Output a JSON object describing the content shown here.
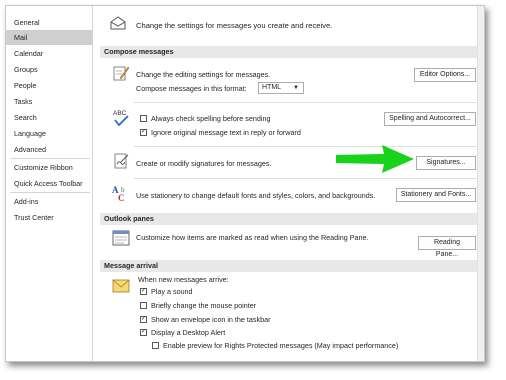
{
  "sidebar": {
    "items": [
      {
        "label": "General"
      },
      {
        "label": "Mail",
        "selected": true
      },
      {
        "label": "Calendar"
      },
      {
        "label": "Groups"
      },
      {
        "label": "People"
      },
      {
        "label": "Tasks"
      },
      {
        "label": "Search"
      },
      {
        "label": "Language"
      },
      {
        "label": "Advanced"
      },
      {
        "label": "Customize Ribbon"
      },
      {
        "label": "Quick Access Toolbar"
      },
      {
        "label": "Add-ins"
      },
      {
        "label": "Trust Center"
      }
    ]
  },
  "header": {
    "text": "Change the settings for messages you create and receive."
  },
  "compose": {
    "section_title": "Compose messages",
    "editing_text": "Change the editing settings for messages.",
    "format_label": "Compose messages in this format:",
    "format_value": "HTML",
    "editor_options_button": "Editor Options...",
    "spell_checkbox": "Always check spelling before sending",
    "spell_checked": false,
    "ignore_checkbox": "Ignore original message text in reply or forward",
    "ignore_checked": true,
    "spelling_button": "Spelling and Autocorrect...",
    "signatures_text": "Create or modify signatures for messages.",
    "signatures_button": "Signatures...",
    "stationery_text": "Use stationery to change default fonts and styles, colors, and backgrounds.",
    "stationery_button": "Stationery and Fonts..."
  },
  "outlook_panes": {
    "section_title": "Outlook panes",
    "reading_text": "Customize how items are marked as read when using the Reading Pane.",
    "reading_button": "Reading Pane..."
  },
  "message_arrival": {
    "section_title": "Message arrival",
    "intro": "When new messages arrive:",
    "options": [
      {
        "label": "Play a sound",
        "checked": true
      },
      {
        "label": "Briefly change the mouse pointer",
        "checked": false
      },
      {
        "label": "Show an envelope icon in the taskbar",
        "checked": true
      },
      {
        "label": "Display a Desktop Alert",
        "checked": true
      },
      {
        "label": "Enable preview for Rights Protected messages (May impact performance)",
        "checked": false
      }
    ]
  },
  "colors": {
    "arrow": "#19d21b",
    "selected_nav": "#cfcfcf",
    "section_bg": "#e8e8e8"
  }
}
